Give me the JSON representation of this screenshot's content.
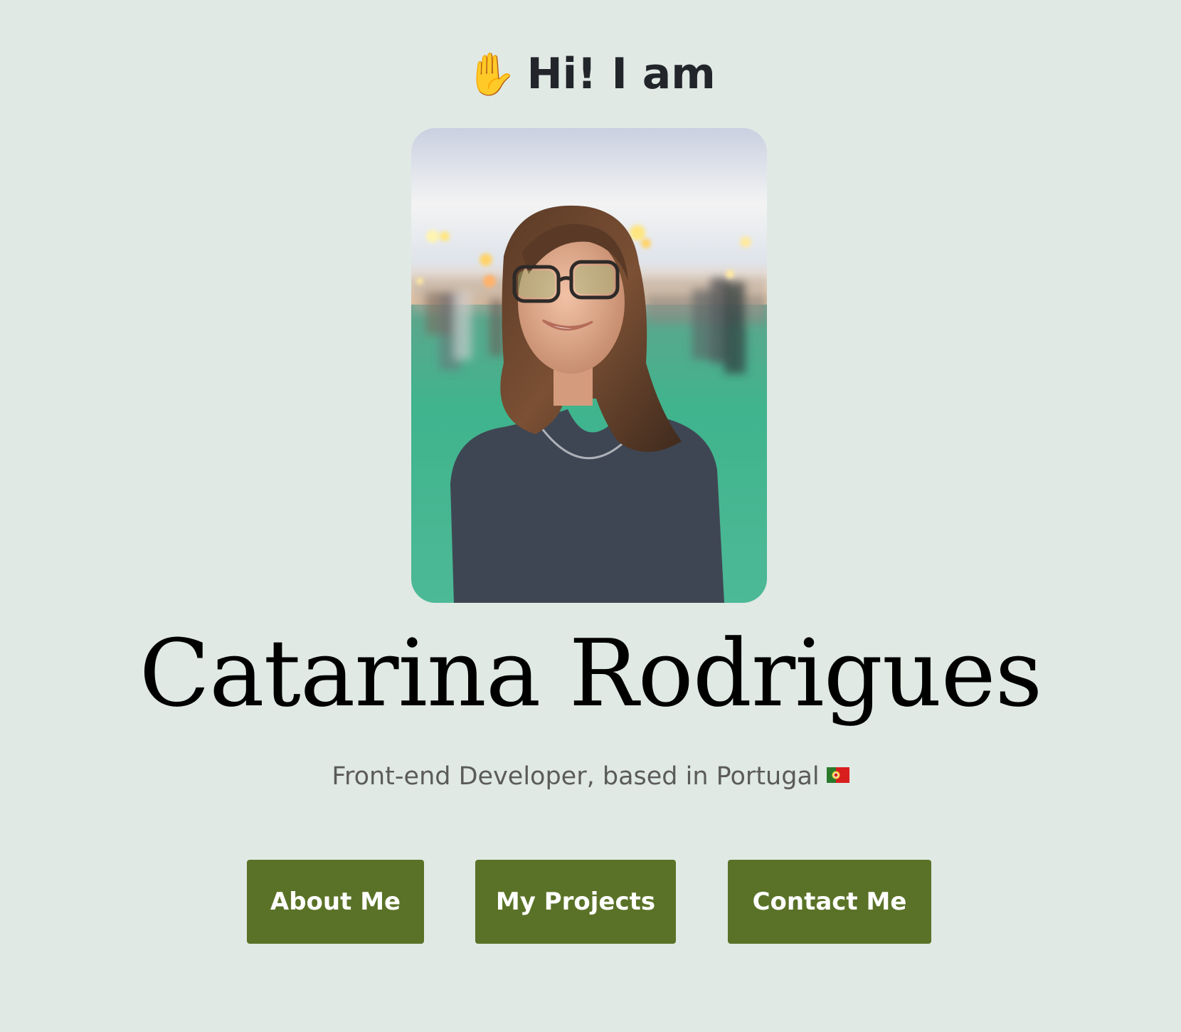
{
  "hero": {
    "greeting": "Hi! I am",
    "greeting_icon": "waving-hand-icon",
    "name": "Catarina Rodrigues",
    "tagline": "Front-end Developer, based in Portugal",
    "tagline_icon": "portugal-flag-icon",
    "photo_alt": "Portrait of Catarina Rodrigues"
  },
  "buttons": {
    "about": "About Me",
    "projects": "My Projects",
    "contact": "Contact Me"
  },
  "colors": {
    "background": "#e0e9e4",
    "button": "#5a7227",
    "heading": "#000000",
    "tagline": "#5b5b5b"
  }
}
